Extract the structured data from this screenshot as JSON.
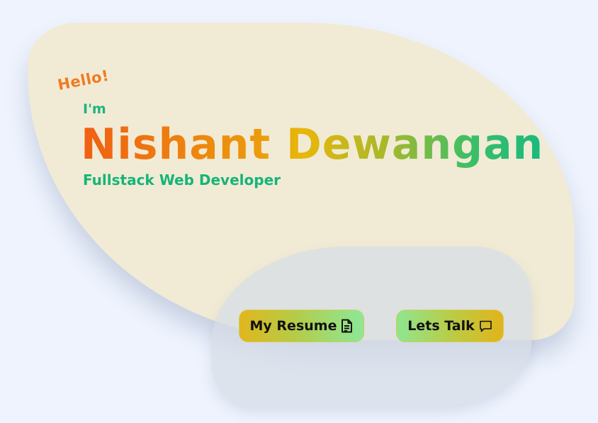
{
  "hero": {
    "greeting": "Hello!",
    "intro": "I'm",
    "name": "Nishant Dewangan",
    "role": "Fullstack Web Developer"
  },
  "actions": {
    "resume_label": "My Resume",
    "resume_icon": "document-icon",
    "talk_label": "Lets Talk",
    "talk_icon": "chat-bubble-icon"
  },
  "colors": {
    "page_background": "#eef3fd",
    "hero_card": "#f1ebd5",
    "greeting": "#f07a22",
    "accent_green": "#1cb57f",
    "name_gradient": [
      "#f05f12",
      "#e8b70a",
      "#1ab97e"
    ],
    "button_gradient": [
      "#e1b61d",
      "#8ce898"
    ]
  }
}
